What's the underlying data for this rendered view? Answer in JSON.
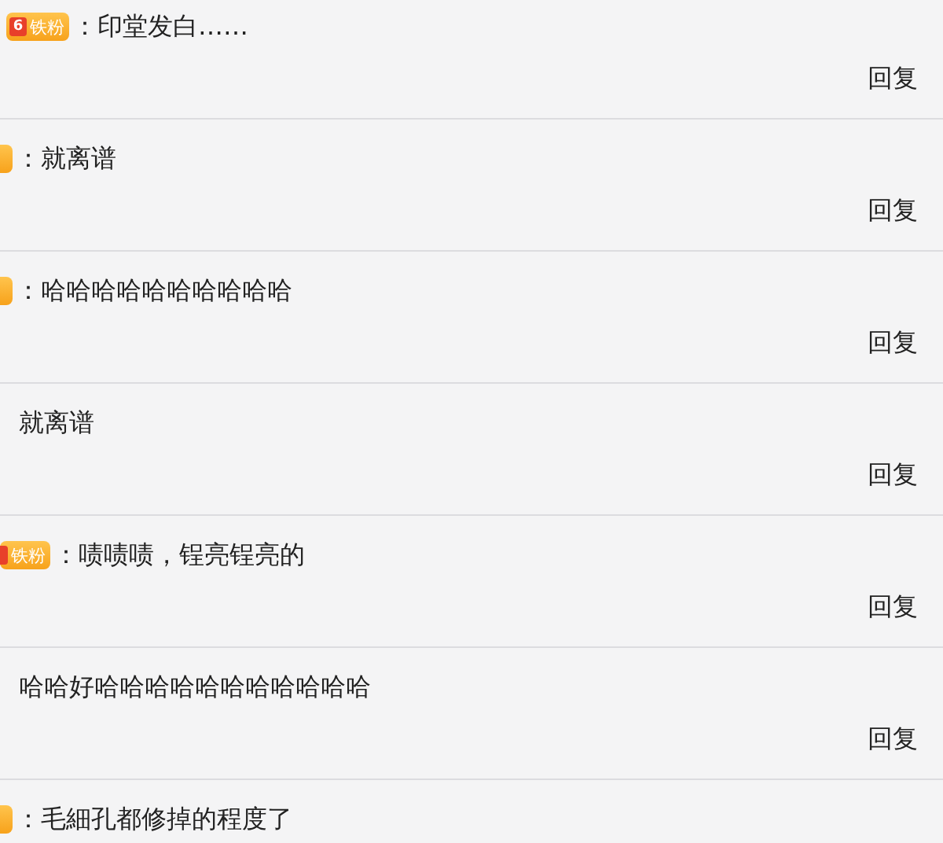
{
  "comments": [
    {
      "badge": {
        "kind": "full",
        "level": "6",
        "label": "铁粉"
      },
      "text": "：印堂发白……",
      "reply": "回复"
    },
    {
      "badge": {
        "kind": "sliver"
      },
      "text": "：就离谱",
      "reply": "回复"
    },
    {
      "badge": {
        "kind": "sliver"
      },
      "text": "：哈哈哈哈哈哈哈哈哈哈",
      "reply": "回复"
    },
    {
      "text": "就离谱",
      "reply": "回复"
    },
    {
      "badge": {
        "kind": "partial",
        "label": "铁粉"
      },
      "text": "：啧啧啧，锃亮锃亮的",
      "reply": "回复"
    },
    {
      "text": "哈哈好哈哈哈哈哈哈哈哈哈哈哈",
      "reply": "回复"
    },
    {
      "badge": {
        "kind": "sliver"
      },
      "text": "：毛細孔都修掉的程度了"
    }
  ]
}
